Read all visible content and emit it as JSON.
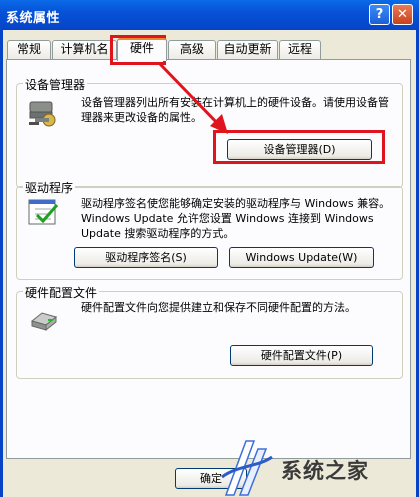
{
  "window": {
    "title": "系统属性",
    "help_label": "?",
    "close_label": "✕"
  },
  "tabs": [
    {
      "label": "常规",
      "active": false
    },
    {
      "label": "计算机名",
      "active": false
    },
    {
      "label": "硬件",
      "active": true
    },
    {
      "label": "高级",
      "active": false
    },
    {
      "label": "自动更新",
      "active": false
    },
    {
      "label": "远程",
      "active": false
    }
  ],
  "device_manager": {
    "group_label": "设备管理器",
    "description": "设备管理器列出所有安装在计算机上的硬件设备。请使用设备管理器来更改设备的属性。",
    "button_label": "设备管理器(D)",
    "icon": "device-manager-icon"
  },
  "drivers": {
    "group_label": "驱动程序",
    "description": "驱动程序签名使您能够确定安装的驱动程序与 Windows 兼容。Windows Update 允许您设置 Windows 连接到 Windows Update 搜索驱动程序的方式。",
    "signing_button": "驱动程序签名(S)",
    "update_button": "Windows Update(W)",
    "icon": "driver-checklist-icon"
  },
  "hardware_profiles": {
    "group_label": "硬件配置文件",
    "description": "硬件配置文件向您提供建立和保存不同硬件配置的方法。",
    "button_label": "硬件配置文件(P)",
    "icon": "hardware-profile-icon"
  },
  "footer": {
    "ok_label": "确定"
  },
  "watermark": {
    "text": "系统之家"
  },
  "colors": {
    "annotation": "#e0141c",
    "titlebar": "#0752d8"
  }
}
